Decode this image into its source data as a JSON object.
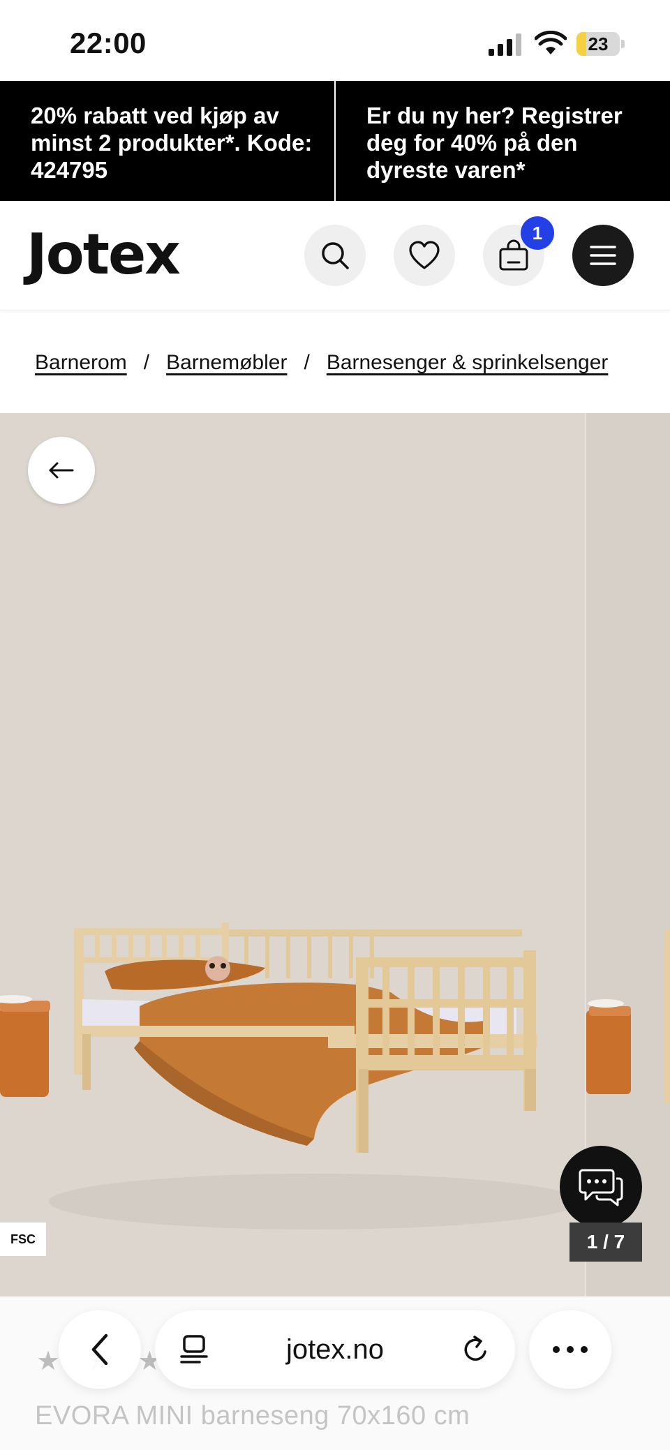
{
  "status_bar": {
    "time": "22:00",
    "battery_level": "23",
    "battery_fraction": 0.23,
    "icons": [
      "signal-icon",
      "wifi-icon",
      "battery-icon"
    ]
  },
  "promo": {
    "left_text": "20% rabatt ved kjøp av minst 2 produkter*. Kode: 424795",
    "right_text": "Er du ny her? Registrer deg for 40% på den dyreste varen*"
  },
  "header": {
    "logo": "Jotex",
    "cart_count": "1",
    "icons": [
      "search-icon",
      "heart-icon",
      "shopping-bag-icon",
      "menu-icon"
    ]
  },
  "breadcrumb": {
    "items": [
      "Barnerom",
      "Barnemøbler",
      "Barnesenger & sprinkelsenger"
    ],
    "separator": "/"
  },
  "gallery": {
    "fsc_label": "FSC",
    "counter": "1 / 7",
    "current_image": 1,
    "total_images": 7,
    "icons": [
      "arrow-left-icon",
      "chat-icon"
    ]
  },
  "product": {
    "rating_stars": "★ ★ ★",
    "title": "EVORA MINI barneseng 70x160 cm"
  },
  "browser_bar": {
    "url": "jotex.no",
    "icons": [
      "chevron-left-icon",
      "tabs-icon",
      "reload-icon",
      "more-icon"
    ]
  },
  "colors": {
    "promo_bg": "#000000",
    "badge_blue": "#2340e6",
    "gallery_bg": "#dcd6cf",
    "bedding_orange": "#c47a34",
    "wood": "#e6cfa4"
  }
}
